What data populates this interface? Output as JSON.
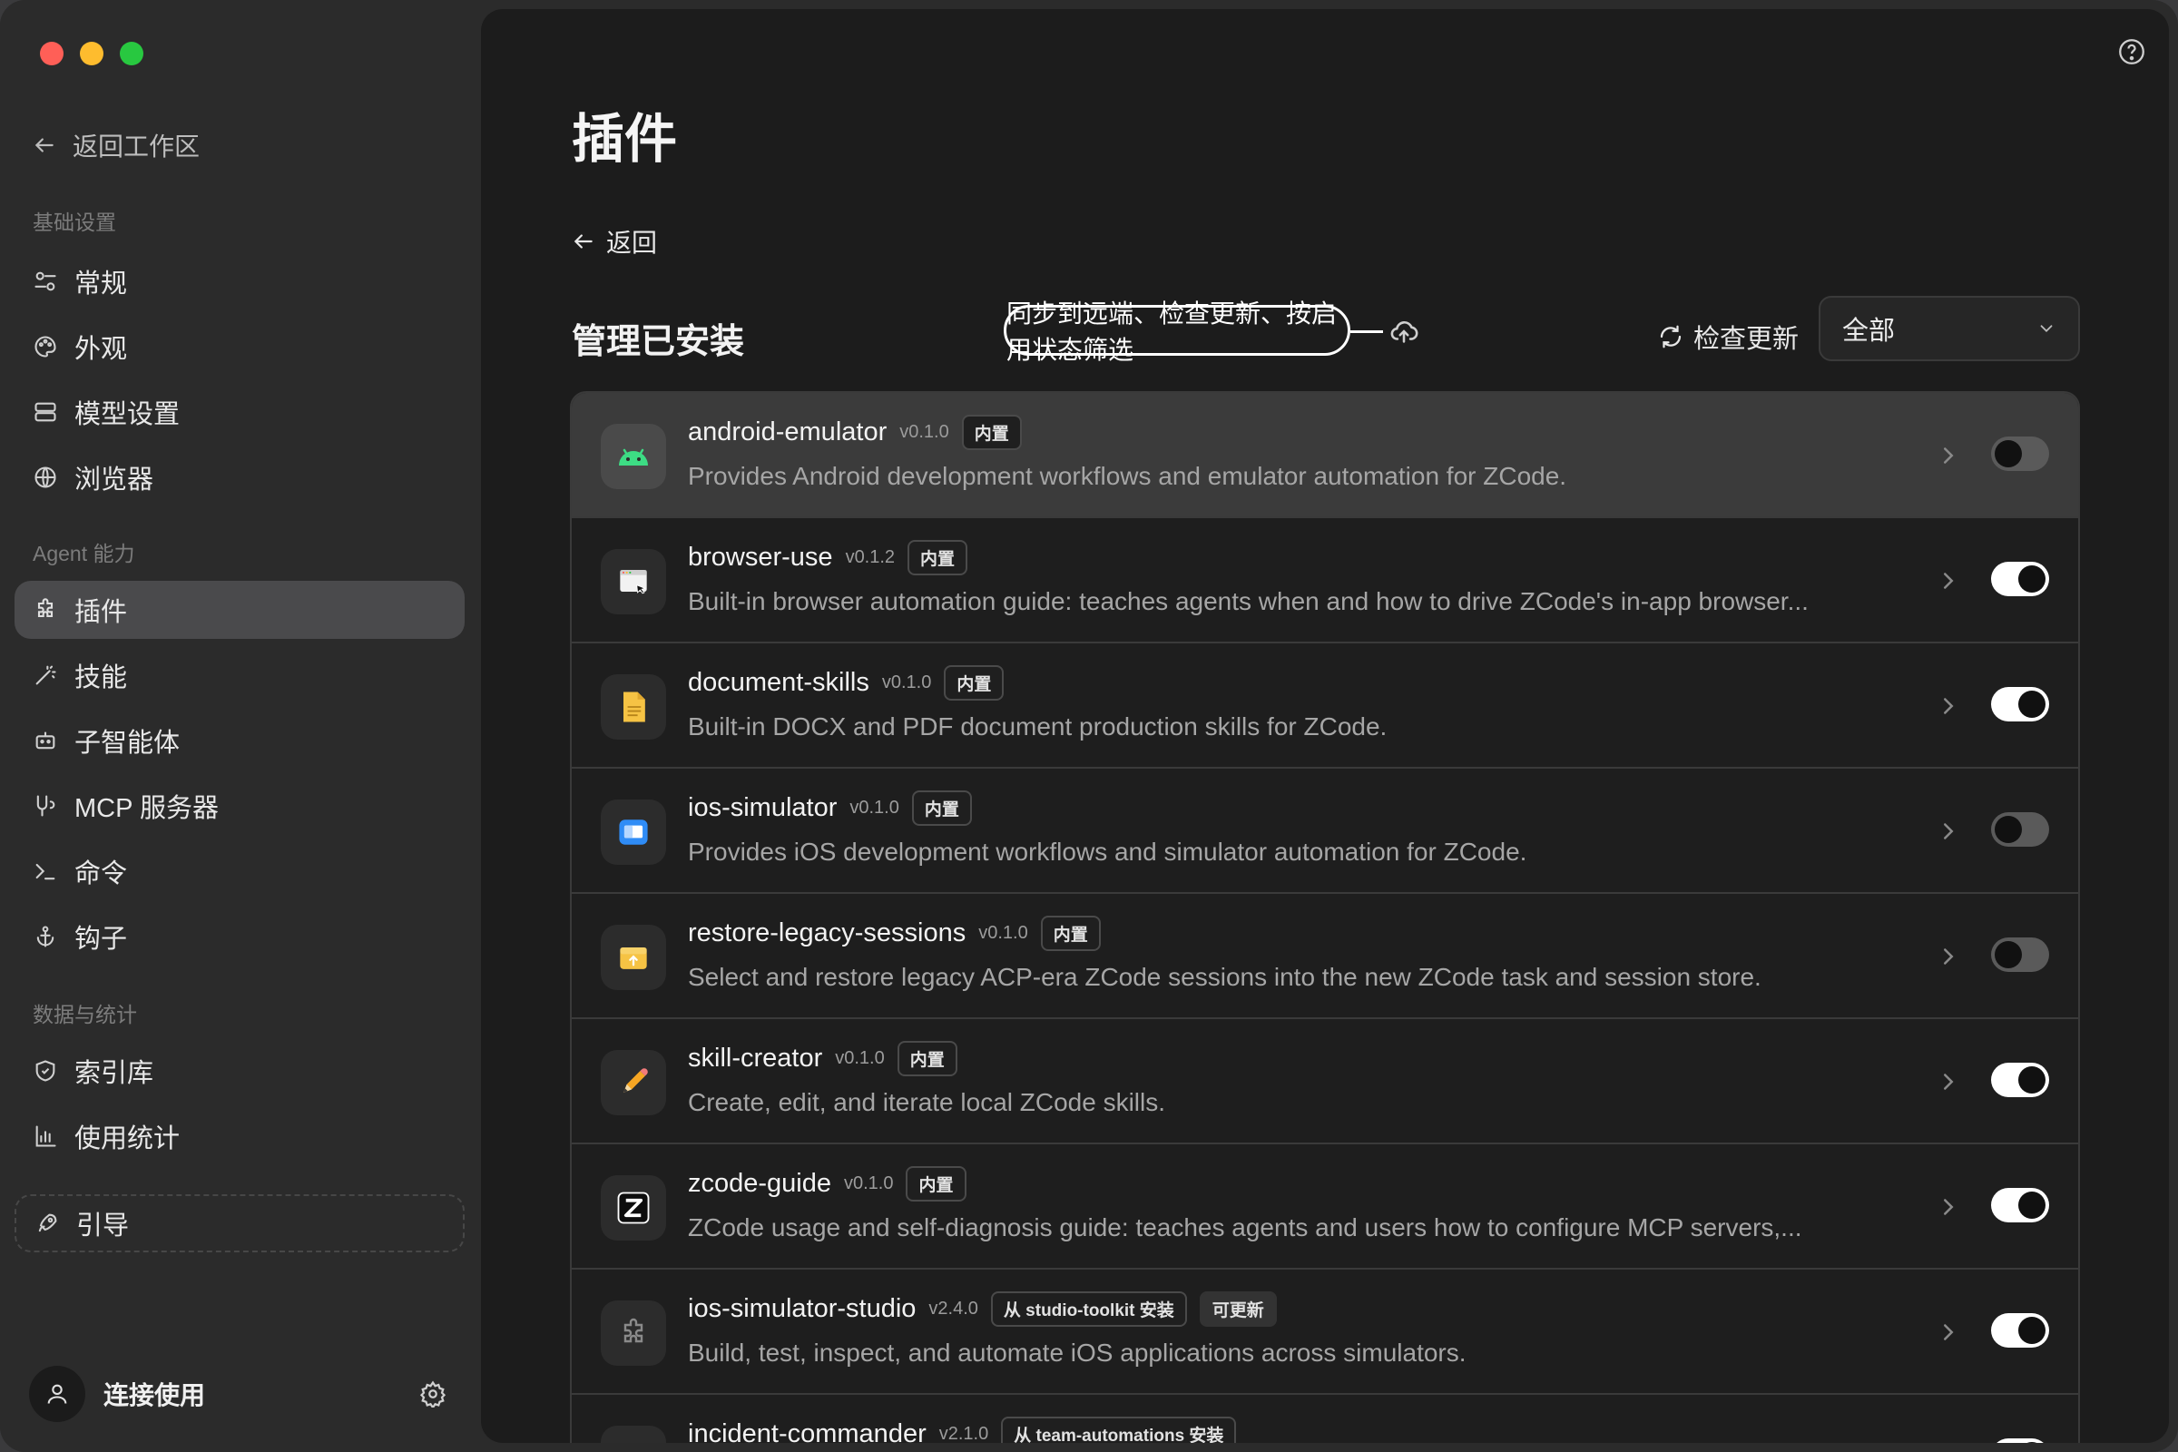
{
  "sidebar": {
    "back_label": "返回工作区",
    "section_basic": "基础设置",
    "section_agent": "Agent 能力",
    "section_data": "数据与统计",
    "items": {
      "general": "常规",
      "appearance": "外观",
      "model": "模型设置",
      "browser": "浏览器",
      "plugins": "插件",
      "skills": "技能",
      "subagents": "子智能体",
      "mcp": "MCP 服务器",
      "commands": "命令",
      "hooks": "钩子",
      "index": "索引库",
      "usage": "使用统计"
    },
    "guide": "引导",
    "user": "连接使用"
  },
  "main": {
    "title": "插件",
    "back": "返回",
    "section": "管理已安装",
    "callout": "同步到远端、检查更新、按启用状态筛选",
    "check_update": "检查更新",
    "filter_value": "全部"
  },
  "plugins": [
    {
      "name": "android-emulator",
      "version": "v0.1.0",
      "badges": [
        "内置"
      ],
      "desc": "Provides Android development workflows and emulator automation for ZCode.",
      "enabled": false,
      "icon": "android-icon"
    },
    {
      "name": "browser-use",
      "version": "v0.1.2",
      "badges": [
        "内置"
      ],
      "desc": "Built-in browser automation guide: teaches agents when and how to drive ZCode's in-app browser...",
      "enabled": true,
      "icon": "browser-window-icon"
    },
    {
      "name": "document-skills",
      "version": "v0.1.0",
      "badges": [
        "内置"
      ],
      "desc": "Built-in DOCX and PDF document production skills for ZCode.",
      "enabled": true,
      "icon": "document-icon"
    },
    {
      "name": "ios-simulator",
      "version": "v0.1.0",
      "badges": [
        "内置"
      ],
      "desc": "Provides iOS development workflows and simulator automation for ZCode.",
      "enabled": false,
      "icon": "simulator-icon"
    },
    {
      "name": "restore-legacy-sessions",
      "version": "v0.1.0",
      "badges": [
        "内置"
      ],
      "desc": "Select and restore legacy ACP-era ZCode sessions into the new ZCode task and session store.",
      "enabled": false,
      "icon": "archive-box-icon"
    },
    {
      "name": "skill-creator",
      "version": "v0.1.0",
      "badges": [
        "内置"
      ],
      "desc": "Create, edit, and iterate local ZCode skills.",
      "enabled": true,
      "icon": "pencil-icon"
    },
    {
      "name": "zcode-guide",
      "version": "v0.1.0",
      "badges": [
        "内置"
      ],
      "desc": "ZCode usage and self-diagnosis guide: teaches agents and users how to configure MCP servers,...",
      "enabled": true,
      "icon": "z-logo-icon"
    },
    {
      "name": "ios-simulator-studio",
      "version": "v2.4.0",
      "badges": [
        "从 studio-toolkit 安装",
        "可更新"
      ],
      "desc": "Build, test, inspect, and automate iOS applications across simulators.",
      "enabled": true,
      "icon": "puzzle-icon"
    },
    {
      "name": "incident-commander",
      "version": "v2.1.0",
      "badges": [
        "从 team-automations 安装"
      ],
      "desc": "",
      "enabled": true,
      "icon": "puzzle-icon"
    }
  ]
}
